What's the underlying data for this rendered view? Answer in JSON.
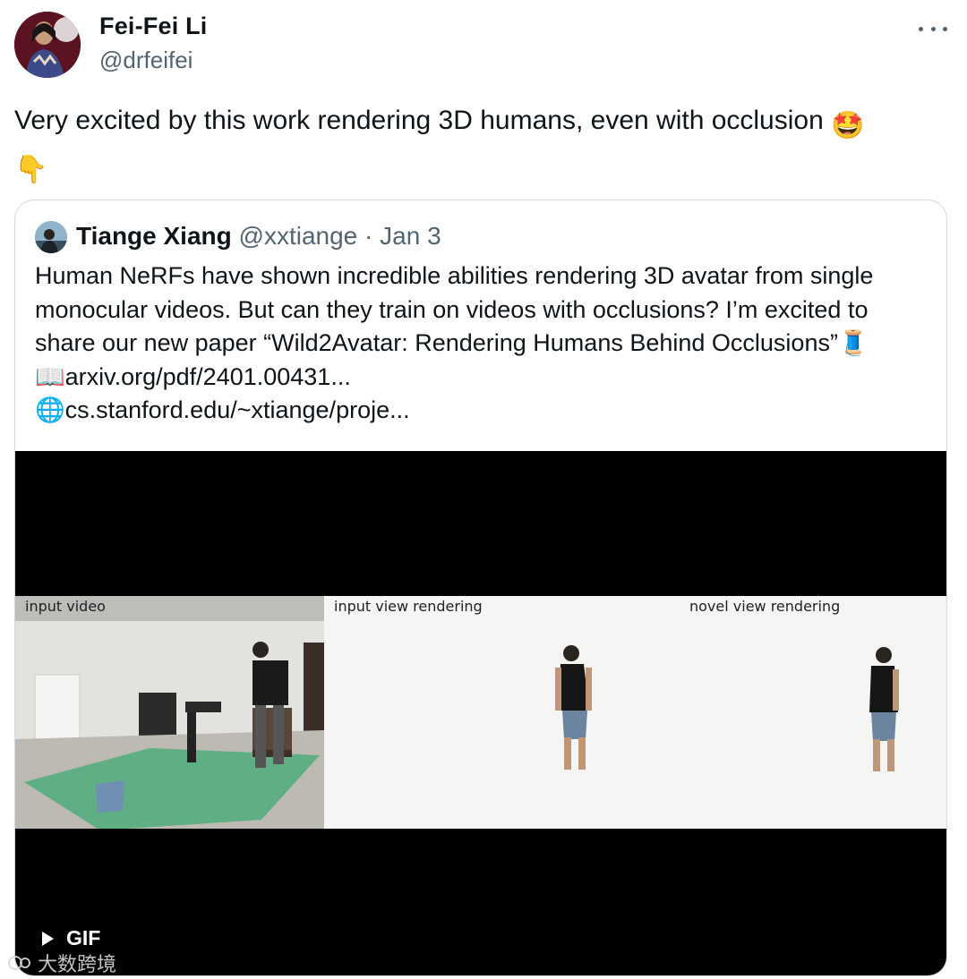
{
  "author": {
    "display_name": "Fei-Fei Li",
    "handle": "@drfeifei",
    "avatar_icon": "profile-photo"
  },
  "tweet": {
    "text": "Very excited by this work rendering 3D humans, even with occlusion",
    "emoji_1": "🤩",
    "emoji_2": "👇"
  },
  "quote": {
    "display_name": "Tiange Xiang",
    "handle": "@xxtiange",
    "dot": "·",
    "date": "Jan 3",
    "lines": [
      "Human NeRFs have shown incredible abilities rendering 3D avatar from single",
      "monocular videos. But can they train on videos with occlusions? I’m excited to",
      "share our new paper “Wild2Avatar: Rendering Humans Behind Occlusions”🧵",
      "📖arxiv.org/pdf/2401.00431...",
      "🌐cs.stanford.edu/~xtiange/proje..."
    ]
  },
  "media": {
    "labels": {
      "input": "input video",
      "render": "input view rendering",
      "novel": "novel view rendering"
    },
    "badge": "GIF"
  },
  "watermark": {
    "text": "大数跨境"
  },
  "colors": {
    "text": "#0f1419",
    "secondary": "#536471",
    "border": "#cfd9de",
    "floor_mat": "#5fae84"
  }
}
